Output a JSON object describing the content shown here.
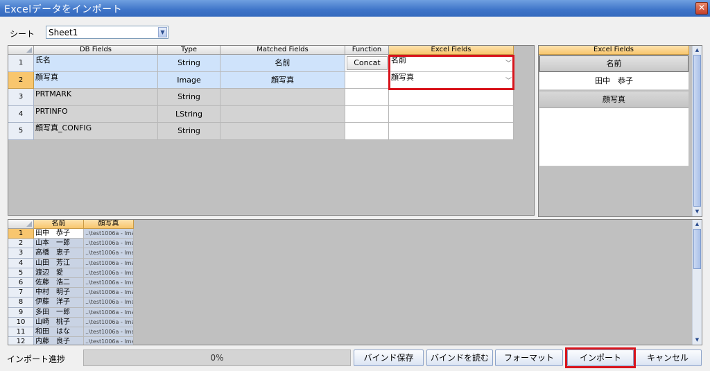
{
  "window": {
    "title": "Excelデータをインポート",
    "close_glyph": "✕"
  },
  "sheet": {
    "label": "シート",
    "value": "Sheet1"
  },
  "mapping": {
    "columns": [
      "DB Fields",
      "Type",
      "Matched Fields",
      "Function",
      "Excel Fields"
    ],
    "rows": [
      {
        "num": "1",
        "db_field": "氏名",
        "type": "String",
        "matched": "名前",
        "function": "Concat",
        "excel": "名前"
      },
      {
        "num": "2",
        "db_field": "顔写真",
        "type": "Image",
        "matched": "顔写真",
        "function": "",
        "excel": "顔写真"
      },
      {
        "num": "3",
        "db_field": "PRTMARK",
        "type": "String",
        "matched": "",
        "function": "",
        "excel": ""
      },
      {
        "num": "4",
        "db_field": "PRTINFO",
        "type": "LString",
        "matched": "",
        "function": "",
        "excel": ""
      },
      {
        "num": "5",
        "db_field": "顔写真_CONFIG",
        "type": "String",
        "matched": "",
        "function": "",
        "excel": ""
      }
    ]
  },
  "excel_panel": {
    "header": "Excel Fields",
    "items": [
      "名前",
      "田中　恭子",
      "顔写真"
    ]
  },
  "preview": {
    "columns": [
      "名前",
      "顔写真"
    ],
    "rows": [
      {
        "num": "1",
        "name": "田中　恭子",
        "photo": "..\\test1006a - Ima"
      },
      {
        "num": "2",
        "name": "山本　一郎",
        "photo": "..\\test1006a - Ima"
      },
      {
        "num": "3",
        "name": "高橋　恵子",
        "photo": "..\\test1006a - Ima"
      },
      {
        "num": "4",
        "name": "山田　芳江",
        "photo": "..\\test1006a - Ima"
      },
      {
        "num": "5",
        "name": "渡辺　愛",
        "photo": "..\\test1006a - Ima"
      },
      {
        "num": "6",
        "name": "佐藤　浩二",
        "photo": "..\\test1006a - Ima"
      },
      {
        "num": "7",
        "name": "中村　明子",
        "photo": "..\\test1006a - Ima"
      },
      {
        "num": "8",
        "name": "伊藤　洋子",
        "photo": "..\\test1006a - Ima"
      },
      {
        "num": "9",
        "name": "多田　一郎",
        "photo": "..\\test1006a - Ima"
      },
      {
        "num": "10",
        "name": "山崎　桃子",
        "photo": "..\\test1006a - Ima"
      },
      {
        "num": "11",
        "name": "和田　はな",
        "photo": "..\\test1006a - Ima"
      },
      {
        "num": "12",
        "name": "内藤　良子",
        "photo": "..\\test1006a - Ima"
      }
    ]
  },
  "footer": {
    "progress_label": "インポート進捗",
    "progress_text": "0%",
    "progress_value": 0,
    "buttons": {
      "save_bind": "バインド保存",
      "load_bind": "バインドを読む",
      "format": "フォーマット",
      "import": "インポート",
      "cancel": "キャンセル"
    }
  },
  "colors": {
    "highlight_box": "#d8141c",
    "selected_row": "#cfe3fb",
    "title_bar": "#3e74c8"
  }
}
